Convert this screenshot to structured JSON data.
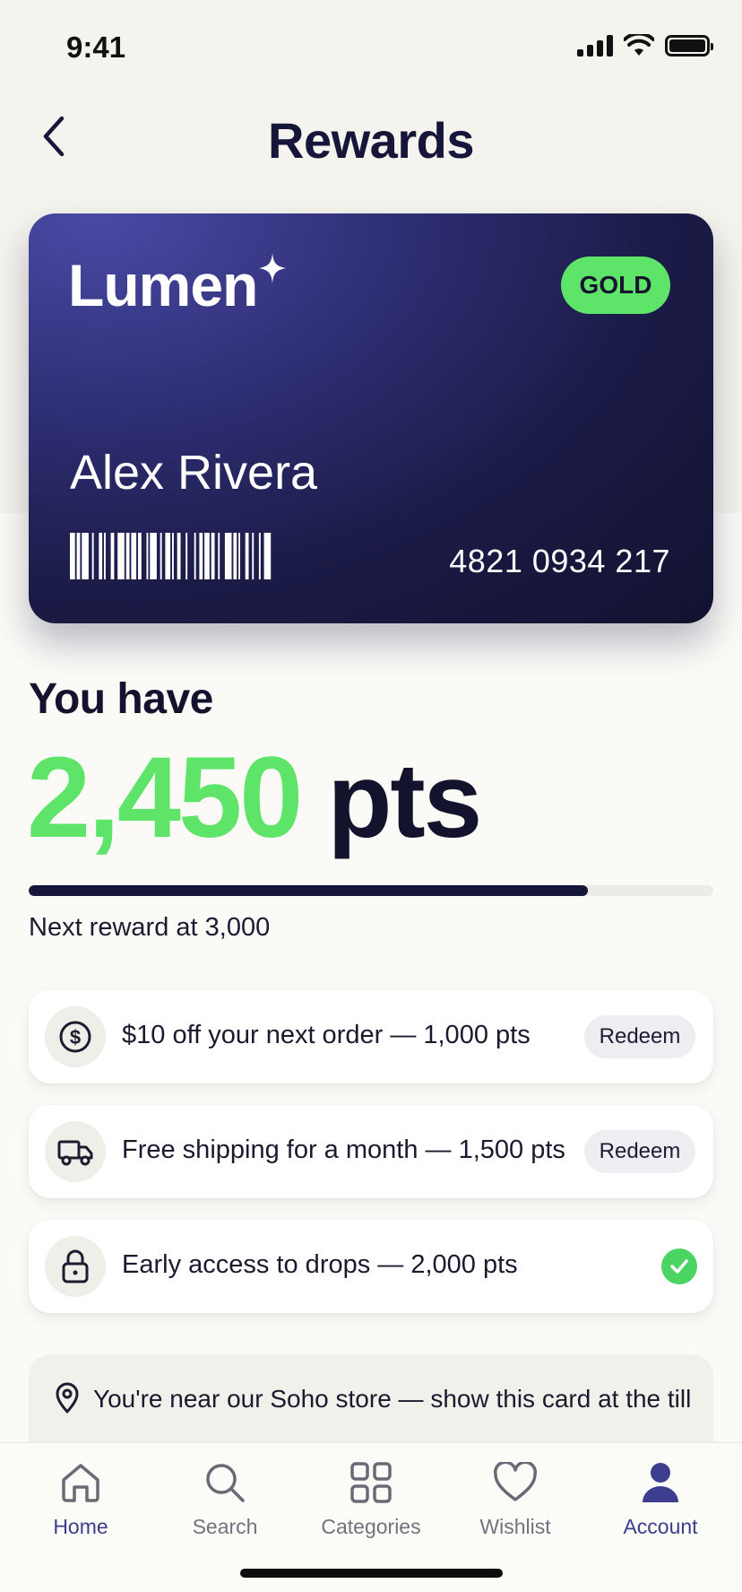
{
  "status_bar": {
    "time": "9:41"
  },
  "header": {
    "title": "Rewards"
  },
  "card": {
    "brand": "Lumen",
    "tier": "GOLD",
    "member_name": "Alex Rivera",
    "card_number": "4821 0934 217"
  },
  "points": {
    "heading": "You have",
    "value": "2,450",
    "unit": "pts",
    "progress_fraction": 0.8167,
    "next_reward": "Next reward at 3,000"
  },
  "rewards": [
    {
      "icon": "dollar-icon",
      "text": "$10 off your next order — 1,000 pts",
      "action": "Redeem"
    },
    {
      "icon": "truck-icon",
      "text": "Free shipping for a month — 1,500 pts",
      "action": "Redeem"
    },
    {
      "icon": "lock-icon",
      "text": "Early access to drops — 2,000 pts",
      "status": "unlocked"
    }
  ],
  "location_banner": {
    "icon": "location-pin-icon",
    "text": "You're near our Soho store — show this card at the till"
  },
  "tab_bar": {
    "active": "Account",
    "tabs": [
      {
        "icon": "home-icon",
        "label": "Home"
      },
      {
        "icon": "search-icon",
        "label": "Search"
      },
      {
        "icon": "categories-icon",
        "label": "Categories"
      },
      {
        "icon": "heart-icon",
        "label": "Wishlist"
      },
      {
        "icon": "account-icon",
        "label": "Account"
      }
    ]
  },
  "colors": {
    "accent_green": "#5fe46a",
    "navy": "#16163a",
    "active_tab": "#3d3d8f"
  }
}
